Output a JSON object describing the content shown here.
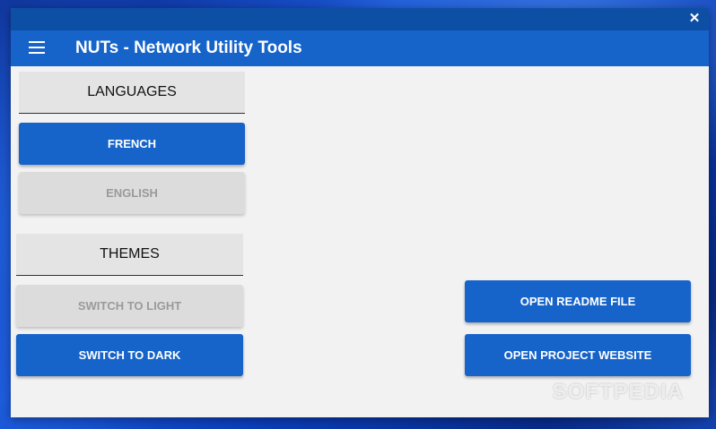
{
  "window": {
    "title": "NUTs - Network Utility Tools",
    "close_glyph": "✕",
    "menu_icon": "hamburger-menu-icon"
  },
  "languages": {
    "header": "LANGUAGES",
    "french_label": "FRENCH",
    "english_label": "ENGLISH"
  },
  "themes": {
    "header": "THEMES",
    "light_label": "SWITCH TO LIGHT",
    "dark_label": "SWITCH TO DARK"
  },
  "actions": {
    "readme_label": "OPEN README FILE",
    "website_label": "OPEN PROJECT WEBSITE"
  },
  "watermark": "SOFTPEDIA",
  "colors": {
    "accent": "#1664c9",
    "title_strip": "#0e4fa6",
    "disabled_bg": "#dcdcdc",
    "disabled_text": "#9a9a9a",
    "content_bg": "#f2f2f2"
  }
}
